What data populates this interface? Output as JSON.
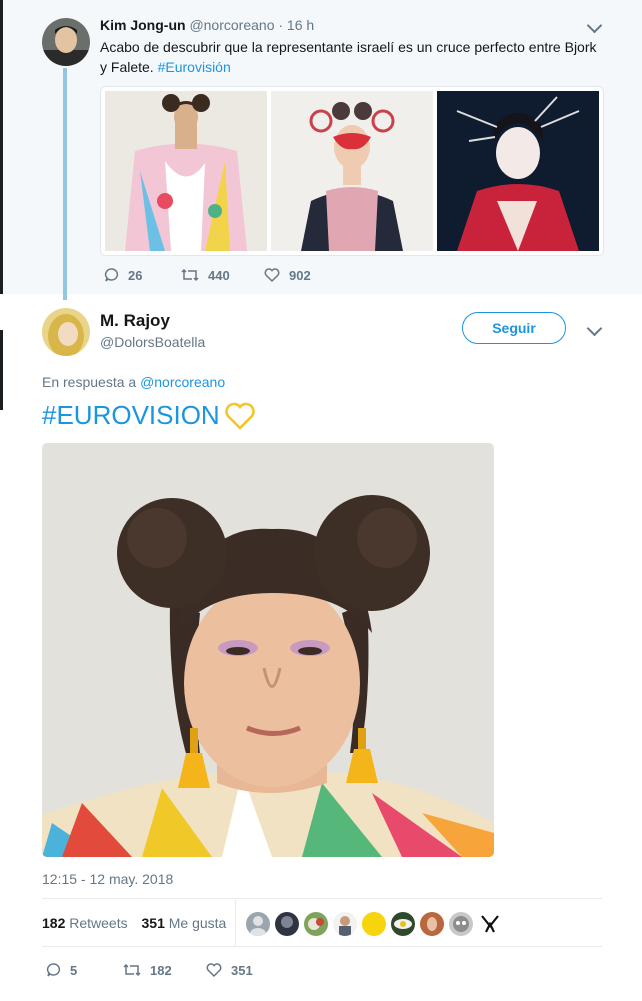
{
  "parent_tweet": {
    "name": "Kim Jong-un",
    "handle": "@norcoreano",
    "time": "· 16 h",
    "text_before": "Acabo de descubrir que la representante israelí es un cruce perfecto entre Bjork y Falete.",
    "hashtag": "#Eurovisión",
    "replies": "26",
    "retweets": "440",
    "likes": "902"
  },
  "main_tweet": {
    "name": "M. Rajoy",
    "handle": "@DolorsBoatella",
    "follow_label": "Seguir",
    "reply_prefix": "En respuesta a",
    "reply_to": "@norcoreano",
    "hashtag": "#EUROVISION",
    "emoji": "💛",
    "timestamp": "12:15 - 12 may. 2018",
    "retweets_count": "182",
    "retweets_label": "Retweets",
    "likes_count": "351",
    "likes_label": "Me gusta",
    "action_replies": "5",
    "action_retweets": "182",
    "action_likes": "351"
  },
  "icons": [
    "reply-icon",
    "retweet-icon",
    "like-icon",
    "chevron-down-icon",
    "heart-emoji-icon"
  ],
  "colors": {
    "link": "#1b95e0",
    "muted": "#657786",
    "thread_line": "#93c6e0",
    "parent_bg": "#f5f8fa"
  }
}
